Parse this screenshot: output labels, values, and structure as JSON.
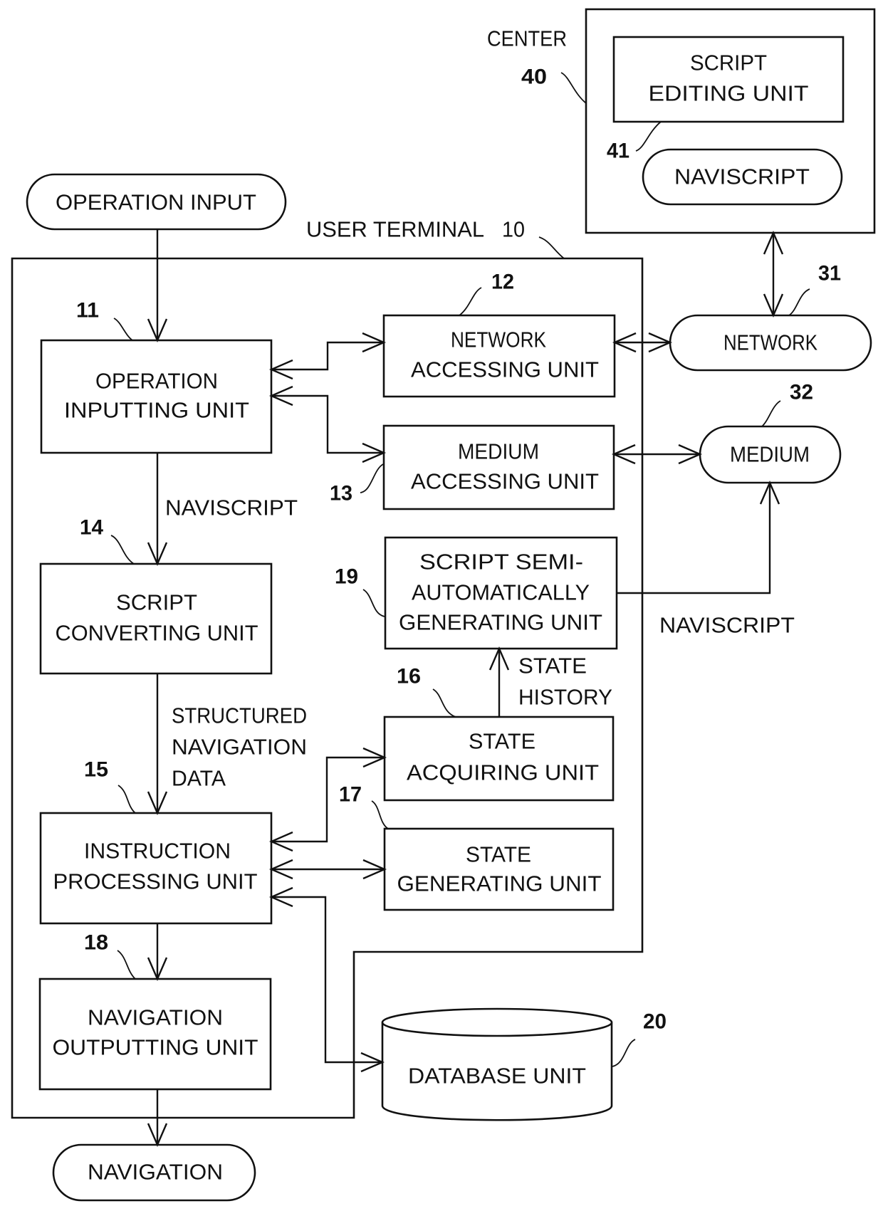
{
  "figure": {
    "user_terminal": {
      "label": "USER TERMINAL",
      "ref": "10"
    },
    "center": {
      "label": "CENTER",
      "ref": "40"
    },
    "nodes": {
      "operation_input": {
        "label": "OPERATION INPUT"
      },
      "operation_inputting_unit": {
        "lines": [
          "OPERATION",
          "INPUTTING UNIT"
        ],
        "ref": "11"
      },
      "network_accessing_unit": {
        "lines": [
          "NETWORK",
          "ACCESSING UNIT"
        ],
        "ref": "12"
      },
      "medium_accessing_unit": {
        "lines": [
          "MEDIUM",
          "ACCESSING UNIT"
        ],
        "ref": "13"
      },
      "script_converting_unit": {
        "lines": [
          "SCRIPT",
          "CONVERTING UNIT"
        ],
        "ref": "14"
      },
      "instruction_processing_unit": {
        "lines": [
          "INSTRUCTION",
          "PROCESSING UNIT"
        ],
        "ref": "15"
      },
      "state_acquiring_unit": {
        "lines": [
          "STATE",
          "ACQUIRING UNIT"
        ],
        "ref": "16"
      },
      "state_generating_unit": {
        "lines": [
          "STATE",
          "GENERATING UNIT"
        ],
        "ref": "17"
      },
      "navigation_outputting_unit": {
        "lines": [
          "NAVIGATION",
          "OUTPUTTING UNIT"
        ],
        "ref": "18"
      },
      "script_semi_auto_unit": {
        "lines": [
          "SCRIPT SEMI-",
          "AUTOMATICALLY",
          "GENERATING UNIT"
        ],
        "ref": "19"
      },
      "database_unit": {
        "label": "DATABASE UNIT",
        "ref": "20"
      },
      "network": {
        "label": "NETWORK",
        "ref": "31"
      },
      "medium": {
        "label": "MEDIUM",
        "ref": "32"
      },
      "script_editing_unit": {
        "lines": [
          "SCRIPT",
          "EDITING UNIT"
        ]
      },
      "naviscript_store": {
        "label": "NAVISCRIPT",
        "ref": "41"
      },
      "navigation": {
        "label": "NAVIGATION"
      }
    },
    "edge_labels": {
      "naviscript_left": "NAVISCRIPT",
      "structured_nav_data": [
        "STRUCTURED",
        "NAVIGATION",
        "DATA"
      ],
      "state_history": [
        "STATE",
        "HISTORY"
      ],
      "naviscript_right": "NAVISCRIPT"
    },
    "edges": [
      {
        "from": "OPERATION INPUT",
        "to": "OPERATION INPUTTING UNIT",
        "direction": "forward"
      },
      {
        "from": "OPERATION INPUTTING UNIT",
        "to": "NETWORK ACCESSING UNIT",
        "direction": "both"
      },
      {
        "from": "OPERATION INPUTTING UNIT",
        "to": "MEDIUM ACCESSING UNIT",
        "direction": "both"
      },
      {
        "from": "NETWORK ACCESSING UNIT",
        "to": "NETWORK",
        "direction": "both"
      },
      {
        "from": "MEDIUM ACCESSING UNIT",
        "to": "MEDIUM",
        "direction": "both"
      },
      {
        "from": "CENTER",
        "to": "NETWORK",
        "direction": "both"
      },
      {
        "from": "OPERATION INPUTTING UNIT",
        "to": "SCRIPT CONVERTING UNIT",
        "direction": "forward",
        "label": "NAVISCRIPT"
      },
      {
        "from": "SCRIPT CONVERTING UNIT",
        "to": "INSTRUCTION PROCESSING UNIT",
        "direction": "forward",
        "label": "STRUCTURED NAVIGATION DATA"
      },
      {
        "from": "STATE ACQUIRING UNIT",
        "to": "SCRIPT SEMI-AUTOMATICALLY GENERATING UNIT",
        "direction": "forward",
        "label": "STATE HISTORY"
      },
      {
        "from": "SCRIPT SEMI-AUTOMATICALLY GENERATING UNIT",
        "to": "MEDIUM",
        "direction": "forward",
        "label": "NAVISCRIPT"
      },
      {
        "from": "INSTRUCTION PROCESSING UNIT",
        "to": "STATE ACQUIRING UNIT",
        "direction": "both"
      },
      {
        "from": "INSTRUCTION PROCESSING UNIT",
        "to": "STATE GENERATING UNIT",
        "direction": "both"
      },
      {
        "from": "INSTRUCTION PROCESSING UNIT",
        "to": "DATABASE UNIT",
        "direction": "both"
      },
      {
        "from": "INSTRUCTION PROCESSING UNIT",
        "to": "NAVIGATION OUTPUTTING UNIT",
        "direction": "forward"
      },
      {
        "from": "NAVIGATION OUTPUTTING UNIT",
        "to": "NAVIGATION",
        "direction": "forward"
      }
    ]
  }
}
